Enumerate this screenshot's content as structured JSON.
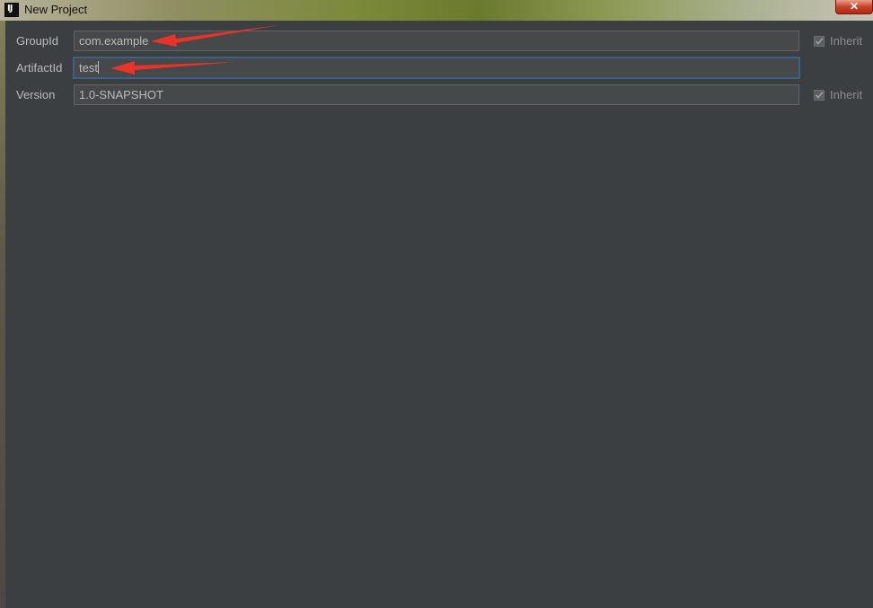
{
  "window": {
    "title": "New Project",
    "app_icon_text": "IJ",
    "close_label": "✕"
  },
  "form": {
    "group_id": {
      "label": "GroupId",
      "value": "com.example",
      "inherit_label": "Inherit",
      "inherit_checked": true
    },
    "artifact_id": {
      "label": "ArtifactId",
      "value": "test"
    },
    "version": {
      "label": "Version",
      "value": "1.0-SNAPSHOT",
      "inherit_label": "Inherit",
      "inherit_checked": true
    }
  },
  "annotations": {
    "arrow_color": "#e8332b"
  },
  "colors": {
    "dialog_bg": "#3c3f41",
    "field_bg": "#45494a",
    "text": "#bbbbbb",
    "focus_border": "#3d6185"
  }
}
